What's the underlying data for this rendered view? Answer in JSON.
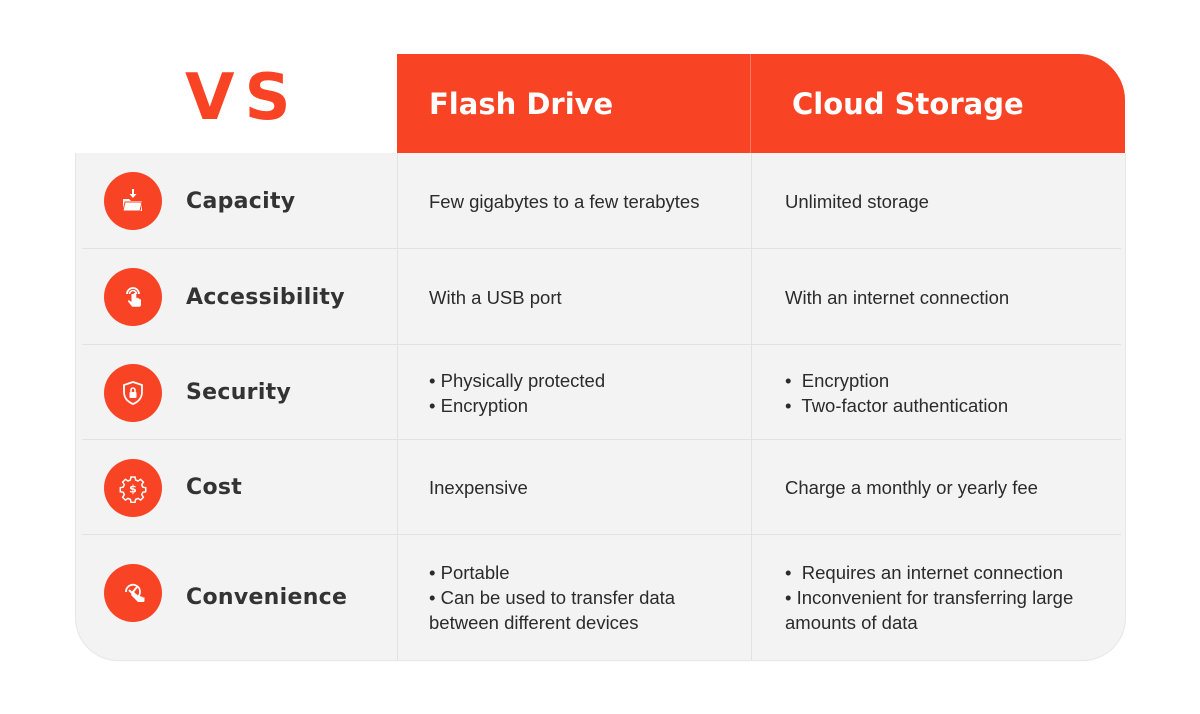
{
  "vs_label": "VS",
  "header": {
    "col1": "Flash Drive",
    "col2": "Cloud Storage"
  },
  "colors": {
    "accent": "#f94325",
    "table_bg": "#f3f3f3"
  },
  "rows": [
    {
      "label": "Capacity",
      "icon": "folder-download-icon",
      "col1": [
        "Few gigabytes to a few terabytes"
      ],
      "col2": [
        "Unlimited storage"
      ]
    },
    {
      "label": "Accessibility",
      "icon": "tap-finger-icon",
      "col1": [
        "With a USB port"
      ],
      "col2": [
        "With an internet connection"
      ]
    },
    {
      "label": "Security",
      "icon": "shield-lock-icon",
      "col1": [
        "• Physically protected",
        "• Encryption"
      ],
      "col2": [
        "•  Encryption",
        "•  Two-factor authentication"
      ]
    },
    {
      "label": "Cost",
      "icon": "gear-dollar-icon",
      "col1": [
        "Inexpensive"
      ],
      "col2": [
        "Charge a monthly or yearly fee"
      ]
    },
    {
      "label": "Convenience",
      "icon": "tap-check-icon",
      "col1": [
        "• Portable",
        "• Can be used to transfer data",
        "between different devices"
      ],
      "col2": [
        "•  Requires an internet connection",
        "• Inconvenient for transferring large",
        "amounts of data"
      ]
    }
  ]
}
